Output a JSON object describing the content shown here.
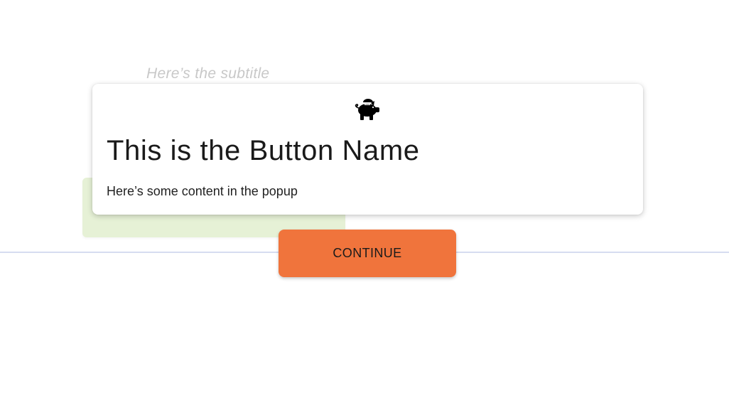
{
  "background": {
    "subtitle": "Here’s the subtitle"
  },
  "popup": {
    "icon": "piggy-bank-icon",
    "title": "This is the Button Name",
    "content": "Here’s some content in the popup"
  },
  "actions": {
    "continue_label": "CONTINUE"
  },
  "colors": {
    "accent": "#f0743c",
    "card_green": "#e6f1d6",
    "divider": "#d6dcf0",
    "subtitle_text": "#c8c8c8"
  }
}
